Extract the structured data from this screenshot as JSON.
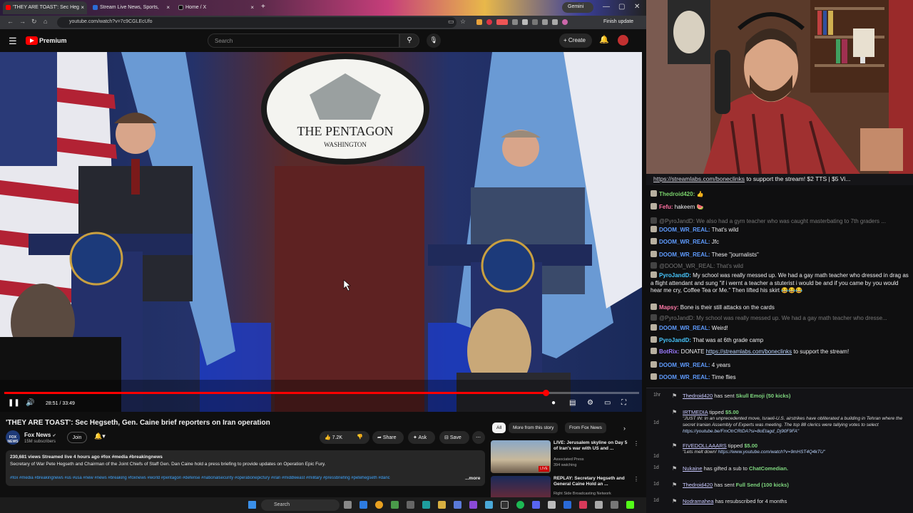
{
  "browser": {
    "tabs": [
      {
        "label": "'THEY ARE TOAST': Sec Heg",
        "active": true
      },
      {
        "label": "Stream Live News, Sports,",
        "active": false
      },
      {
        "label": "Home / X",
        "active": false
      }
    ],
    "gemini_label": "Gemini",
    "url": "youtube.com/watch?v=7c9CGLEcUfo",
    "finish_update": "Finish update"
  },
  "youtube": {
    "brand": "Premium",
    "search_placeholder": "Search",
    "create_label": "Create",
    "video": {
      "scene_text_top": "THE PENTAGON",
      "scene_text_sub": "WASHINGTON",
      "elapsed": "28:51 / 33:49",
      "progress_fraction": 0.853
    },
    "title": "'THEY ARE TOAST': Sec Hegseth, Gen. Caine brief reporters on Iran operation",
    "channel": {
      "name": "Fox News",
      "logo_text": "FOX NEWS",
      "subs": "15M subscribers",
      "join": "Join"
    },
    "actions": {
      "likes": "7.2K",
      "share": "Share",
      "ask": "Ask",
      "save": "Save"
    },
    "description": {
      "meta": "230,681 views  Streamed live 4 hours ago  #fox #media #breakingnews",
      "text": "Secretary of War Pete Hegseth and Chairman of the Joint Chiefs of Staff Gen. Dan Caine hold a press briefing to provide updates on Operation Epic Fury.",
      "tags": "#fox #media #breakingnews #us #usa #new #news #breaking #foxnews #world #pentagon #defense #nationalsecurity #operationepicfury #iran #middleeast #military #pressbriefing #petehegseth #danc",
      "more": "...more"
    },
    "chips": [
      "All",
      "More from this story",
      "From Fox News"
    ],
    "recommendations": [
      {
        "title": "LIVE: Jerusalem skyline on Day 5 of Iran's war with US and ...",
        "channel": "Associated Press",
        "stats": "394 watching",
        "badge": "LIVE"
      },
      {
        "title": "REPLAY: Secretary Hegseth and General Caine Hold an ...",
        "channel": "Right Side Broadcasting Network",
        "stats": "",
        "badge": ""
      }
    ]
  },
  "taskbar": {
    "search": "Search"
  },
  "chat": {
    "pinned_link": "https://streamlabs.com/boneclinks",
    "pinned_text": " to support the stream! $2 TTS | $5 Vi...",
    "messages": [
      {
        "user": "Thedroid420:",
        "text": " 👍",
        "color": "#7ad26b",
        "dim": false
      },
      {
        "user": "Fefu:",
        "text": " hakeem 🍉",
        "color": "#ff6fa1",
        "dim": false
      },
      {
        "user": "@PyroJandD:",
        "text": " We also had a gym teacher who was caught masterbating to 7th graders ...",
        "color": "#777",
        "dim": true
      },
      {
        "user": "DOOM_WR_REAL:",
        "text": " That's wild",
        "color": "#5f9cff",
        "dim": false
      },
      {
        "user": "DOOM_WR_REAL:",
        "text": " Jfc",
        "color": "#5f9cff",
        "dim": false
      },
      {
        "user": "DOOM_WR_REAL:",
        "text": " These \"journalists\"",
        "color": "#5f9cff",
        "dim": false
      },
      {
        "user": "@DOOM_WR_REAL:",
        "text": " That's wild",
        "color": "#777",
        "dim": true
      },
      {
        "user": "PyroJandD:",
        "text": " My school was really messed up. We had a gay math teacher who dressed in drag as a flight attendant and sung \"if i wernt a teacher a stuterist i would be and if you came by you would hear me cry, Coffee Tea or Me.\" Then lifted his skirt 😂😂😂",
        "color": "#47c7ff",
        "dim": false
      },
      {
        "user": "Mapsy:",
        "text": " Bone is their still attacks on the cards",
        "color": "#ff7aa8",
        "dim": false
      },
      {
        "user": "@PyroJandD:",
        "text": " My school was really messed up. We had a gay math teacher who dresse...",
        "color": "#777",
        "dim": true
      },
      {
        "user": "DOOM_WR_REAL:",
        "text": " Weird!",
        "color": "#5f9cff",
        "dim": false
      },
      {
        "user": "PyroJandD:",
        "text": " That was at 6th grade camp",
        "color": "#47c7ff",
        "dim": false
      },
      {
        "user": "BotRix:",
        "text": " DONATE ",
        "link": "https://streamlabs.com/boneclinks",
        "after": " to support the stream!",
        "color": "#9b7aff",
        "dim": false
      },
      {
        "user": "DOOM_WR_REAL:",
        "text": " 4 years",
        "color": "#5f9cff",
        "dim": false
      },
      {
        "user": "DOOM_WR_REAL:",
        "text": " Time flies",
        "color": "#5f9cff",
        "dim": false
      }
    ]
  },
  "events": [
    {
      "time": "1hr",
      "name": "Thedroid420",
      "action": " has sent ",
      "item": "Skull Emoji (50 kicks)",
      "quote": "",
      "link": ""
    },
    {
      "time": "",
      "name": "IRTMEDIA",
      "action": " tipped ",
      "item": "$5.00",
      "quote": "\"JUST IN: In an unprecedented move, Israeli-U.S. airstrikes have obliterated a building in Tehran where the secret Iranian Assembly of Experts was meeting. The top 88 clerics were tallying votes to select ",
      "link": "https://youtube.be/FmOtrCRtDA?si=8oEtagd_Dj90F9FA\""
    },
    {
      "time": "1d",
      "name": "FIVEDOLLAAARS",
      "action": " tipped ",
      "item": "$5.00",
      "quote": "\"Lets melt down! ",
      "link": "https://www.youtube.com/watch?v=9mHST4Q4kTU\""
    },
    {
      "time": "1d",
      "name": "Nukaine",
      "action": " has gifted a sub to ",
      "item": "ChatComedian.",
      "quote": "",
      "link": ""
    },
    {
      "time": "1d",
      "name": "Thedroid420",
      "action": " has sent ",
      "item": "Full Send (100 kicks)",
      "quote": "",
      "link": ""
    },
    {
      "time": "1d",
      "name": "Nodramahea",
      "action": " has resubscribed for 4 months",
      "item": "",
      "quote": "",
      "link": ""
    }
  ],
  "event_time_irt": "1d"
}
